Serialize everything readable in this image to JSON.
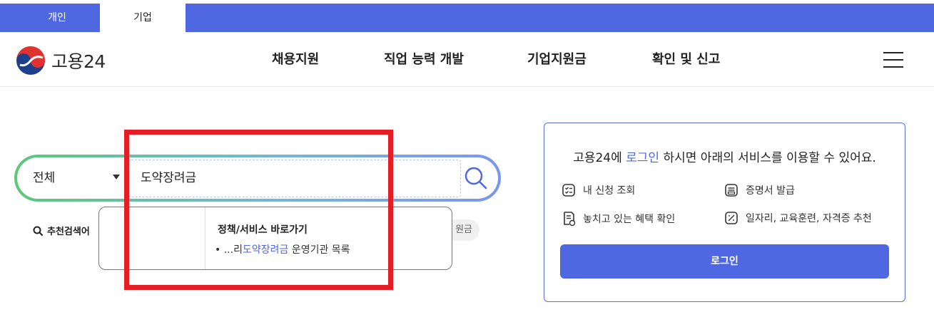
{
  "audience_tabs": [
    {
      "label": "개인",
      "selected": false
    },
    {
      "label": "기업",
      "selected": true
    }
  ],
  "header": {
    "logo_text": "고용24",
    "nav": [
      "채용지원",
      "직업 능력 개발",
      "기업지원금",
      "확인 및 신고"
    ]
  },
  "search": {
    "scope": "전체",
    "query": "도약장려금",
    "recommend_label": "추천검색어",
    "chip_visible_text": "원금"
  },
  "autocomplete": {
    "section_title": "정책/서비스 바로가기",
    "item": {
      "bullet": "•",
      "prefix": "...리",
      "highlight": "도약장려금",
      "suffix": " 운영기관 목록"
    }
  },
  "login_panel": {
    "message_before": "고용24에 ",
    "message_link": "로그인",
    "message_after": " 하시면 아래의 서비스를 이용할 수 있어요.",
    "services": [
      {
        "label": "내 신청 조회",
        "icon": "checklist-icon"
      },
      {
        "label": "증명서 발급",
        "icon": "certificate-icon"
      },
      {
        "label": "놓치고 있는 혜택 확인",
        "icon": "benefit-document-icon"
      },
      {
        "label": "일자리, 교육훈련, 자격증 추천",
        "icon": "recommend-icon"
      }
    ],
    "button_label": "로그인"
  },
  "colors": {
    "primary": "#4f67e0",
    "highlight_box": "#e51e25",
    "search_gradient_start": "#5cc87a",
    "search_gradient_end": "#7c95ee"
  }
}
